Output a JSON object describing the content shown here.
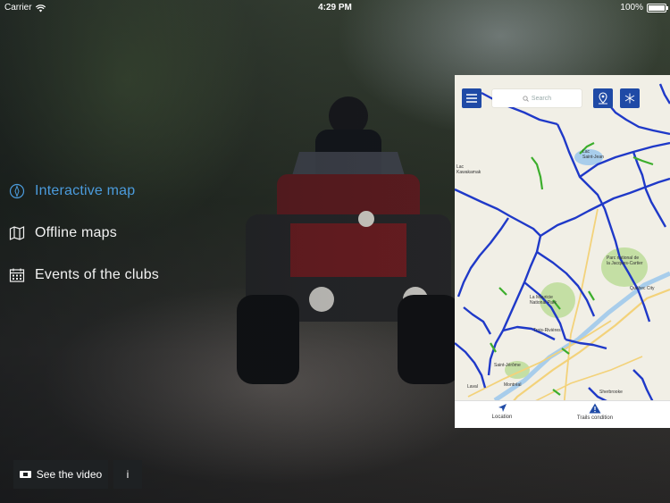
{
  "status_bar": {
    "carrier": "Carrier",
    "time": "4:29 PM",
    "battery": "100%"
  },
  "menu": {
    "items": [
      {
        "label": "Interactive map",
        "icon": "compass-icon",
        "active": true
      },
      {
        "label": "Offline maps",
        "icon": "map-icon",
        "active": false
      },
      {
        "label": "Events of the clubs",
        "icon": "calendar-icon",
        "active": false
      }
    ]
  },
  "buttons": {
    "video_label": "See the video",
    "info_label": "i"
  },
  "map_preview": {
    "search_placeholder": "Search",
    "bottom_tabs": [
      {
        "label": "Location",
        "icon": "navigation-arrow-icon"
      },
      {
        "label": "Trails condition",
        "icon": "warning-triangle-icon"
      }
    ],
    "place_labels": {
      "lac_st_jean": "Lac\nSaint-Jean",
      "lac_kiskissink": "Lac\nKiskissink",
      "parc_jacques_cartier": "Parc national de\nla Jacques-Cartier",
      "quebec_city": "Québec City",
      "la_mauricie": "La Mauricie\nNational Park",
      "trois_rivieres": "Trois-Rivières",
      "montreal": "Montréal",
      "laval": "Laval",
      "sherbrooke": "Sherbrooke",
      "saint_jerome": "Saint-Jérôme",
      "lac_kawikamak": "Lac\nKawakamak",
      "saint_jean": "Saint-Jean",
      "lac_saint_jean": "Lac\nSaint-Jean"
    },
    "colors": {
      "trail_blue": "#1f39c8",
      "trail_green": "#3cae2c",
      "park_green": "#c4dfa4",
      "water": "#a8cdeb",
      "road_yellow": "#f3d27a",
      "accent": "#1f4aa6"
    }
  },
  "colors": {
    "active_menu": "#4b9bdc",
    "menu_text": "#f2f2f2",
    "button_bg": "#1e2123"
  }
}
